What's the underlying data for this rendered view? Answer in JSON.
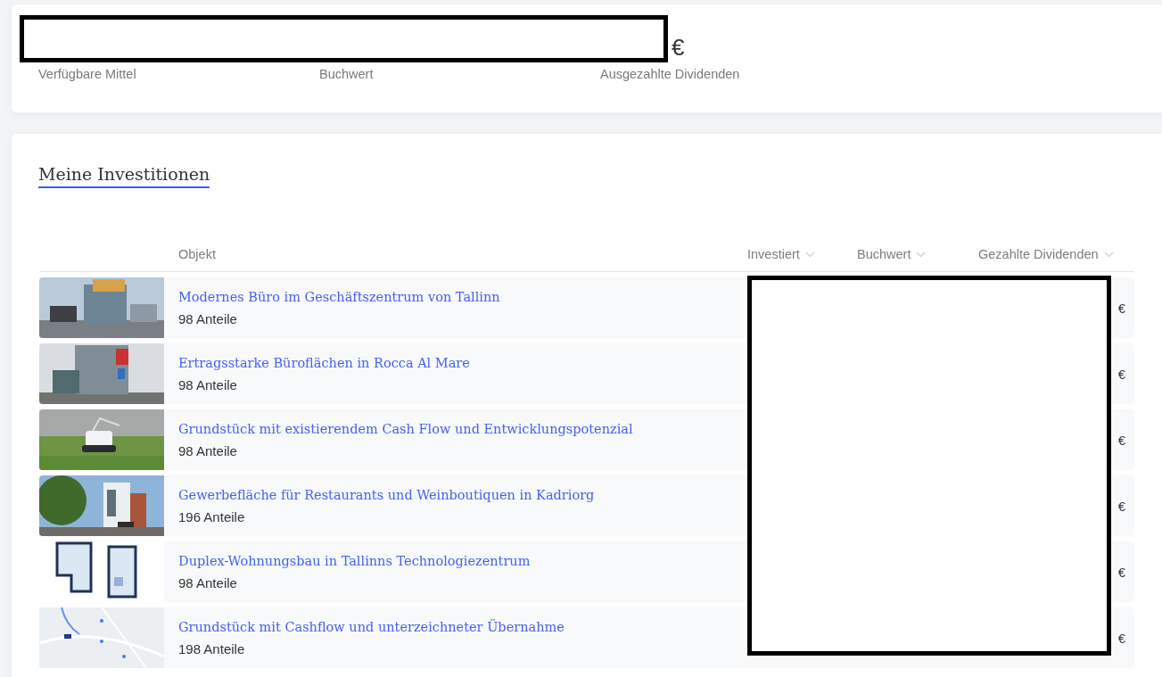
{
  "summary": {
    "currency": "€",
    "labels": [
      "Verfügbare Mittel",
      "Buchwert",
      "Ausgezahlte Dividenden"
    ]
  },
  "investments": {
    "title": "Meine Investitionen",
    "columns": [
      {
        "label": "Objekt",
        "sortable": false
      },
      {
        "label": "Investiert",
        "sortable": true
      },
      {
        "label": "Buchwert",
        "sortable": true
      },
      {
        "label": "Gezahlte Dividenden",
        "sortable": true
      }
    ],
    "rows": [
      {
        "name": "Modernes Büro im Geschäftszentrum von Tallinn",
        "shares": "98 Anteile",
        "currency": "€"
      },
      {
        "name": "Ertragsstarke Büroflächen in Rocca Al Mare",
        "shares": "98 Anteile",
        "currency": "€"
      },
      {
        "name": "Grundstück mit existierendem Cash Flow und Entwicklungspotenzial",
        "shares": "98 Anteile",
        "currency": "€"
      },
      {
        "name": "Gewerbefläche für Restaurants und Weinboutiquen in Kadriorg",
        "shares": "196 Anteile",
        "currency": "€"
      },
      {
        "name": "Duplex-Wohnungsbau in Tallinns Technologiezentrum",
        "shares": "98 Anteile",
        "currency": "€"
      },
      {
        "name": "Grundstück mit Cashflow und unterzeichneter Übernahme",
        "shares": "198 Anteile",
        "currency": "€"
      }
    ]
  }
}
